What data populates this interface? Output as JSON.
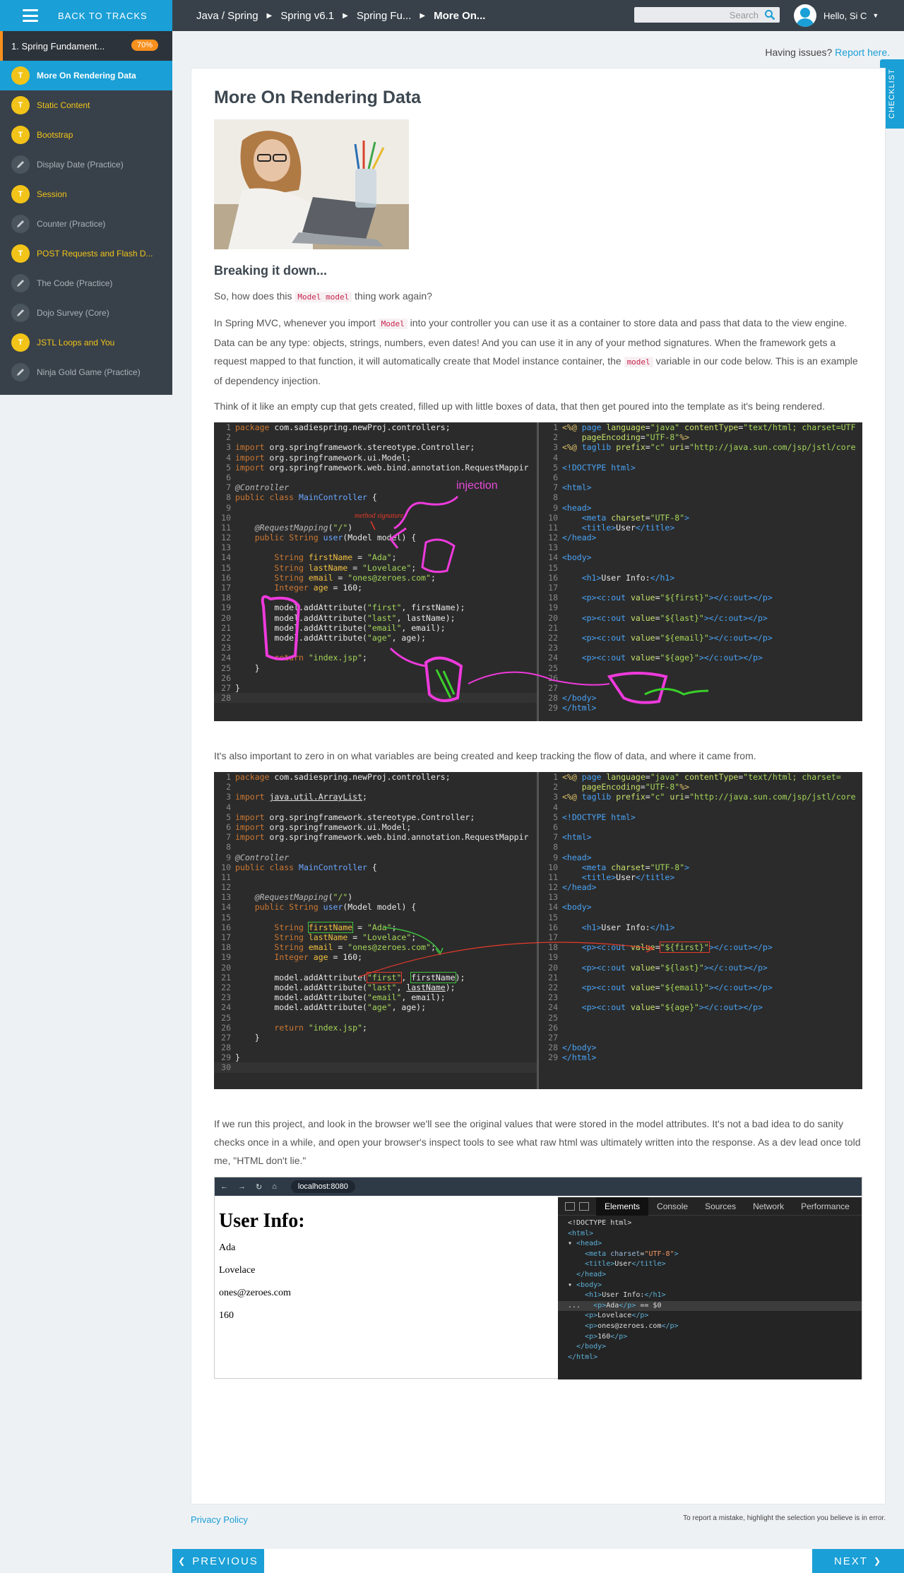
{
  "topbar": {
    "back_label": "BACK TO TRACKS",
    "breadcrumbs": [
      "Java / Spring",
      "Spring v6.1",
      "Spring Fu...",
      "More On..."
    ],
    "search_placeholder": "Search",
    "user_label": "Hello, Si C"
  },
  "sidebar": {
    "course_title": "1. Spring Fundament...",
    "course_progress": "70%",
    "items": [
      {
        "label": "More On Rendering Data",
        "kind": "lesson",
        "active": true
      },
      {
        "label": "Static Content",
        "kind": "lesson"
      },
      {
        "label": "Bootstrap",
        "kind": "lesson"
      },
      {
        "label": "Display Date (Practice)",
        "kind": "practice"
      },
      {
        "label": "Session",
        "kind": "lesson"
      },
      {
        "label": "Counter (Practice)",
        "kind": "practice"
      },
      {
        "label": "POST Requests and Flash D...",
        "kind": "lesson"
      },
      {
        "label": "The Code (Practice)",
        "kind": "practice"
      },
      {
        "label": "Dojo Survey (Core)",
        "kind": "practice"
      },
      {
        "label": "JSTL Loops and You",
        "kind": "lesson"
      },
      {
        "label": "Ninja Gold Game (Practice)",
        "kind": "practice"
      }
    ],
    "lesson_icon_letter": "T"
  },
  "issues": {
    "text": "Having issues?",
    "link": "Report here."
  },
  "checklist_label": "CHECKLIST",
  "article": {
    "title": "More On Rendering Data",
    "subtitle": "Breaking it down...",
    "p1_before": "So, how does this ",
    "p1_code": "Model model",
    "p1_after": " thing work again?",
    "p2_a": "In Spring MVC, whenever you import ",
    "p2_code1": "Model",
    "p2_b": " into your controller you can use it as a container to store data and pass that data to the view engine. Data can be any type: objects, strings, numbers, even dates! And you can use it in any of your method signatures. When the framework gets a request mapped to that function, it will automatically create that Model instance container, the ",
    "p2_code2": "model",
    "p2_c": " variable in our code below. This is an example of dependency injection.",
    "p3": "Think of it like an empty cup that gets created, filled up with little boxes of data, that then get poured into the template as it's being rendered.",
    "p4": "It's also important to zero in on what variables are being created and keep tracking the flow of data, and where it came from.",
    "p5": "If we run this project, and look in the browser we'll see the original values that were stored in the model attributes. It's not a bad idea to do sanity checks once in a while, and open your browser's inspect tools to see what raw html was ultimately written into the response. As a dev lead once told me, \"HTML don't lie.\""
  },
  "annotations": {
    "injection": "injection",
    "method_signature": "method signature"
  },
  "browser": {
    "url": "localhost:8080",
    "heading": "User Info:",
    "values": [
      "Ada",
      "Lovelace",
      "ones@zeroes.com",
      "160"
    ],
    "dev_tabs": [
      "Elements",
      "Console",
      "Sources",
      "Network",
      "Performance"
    ]
  },
  "footer": {
    "privacy": "Privacy Policy",
    "note": "To report a mistake, highlight the selection you believe is in error.",
    "prev": "PREVIOUS",
    "next": "NEXT"
  }
}
